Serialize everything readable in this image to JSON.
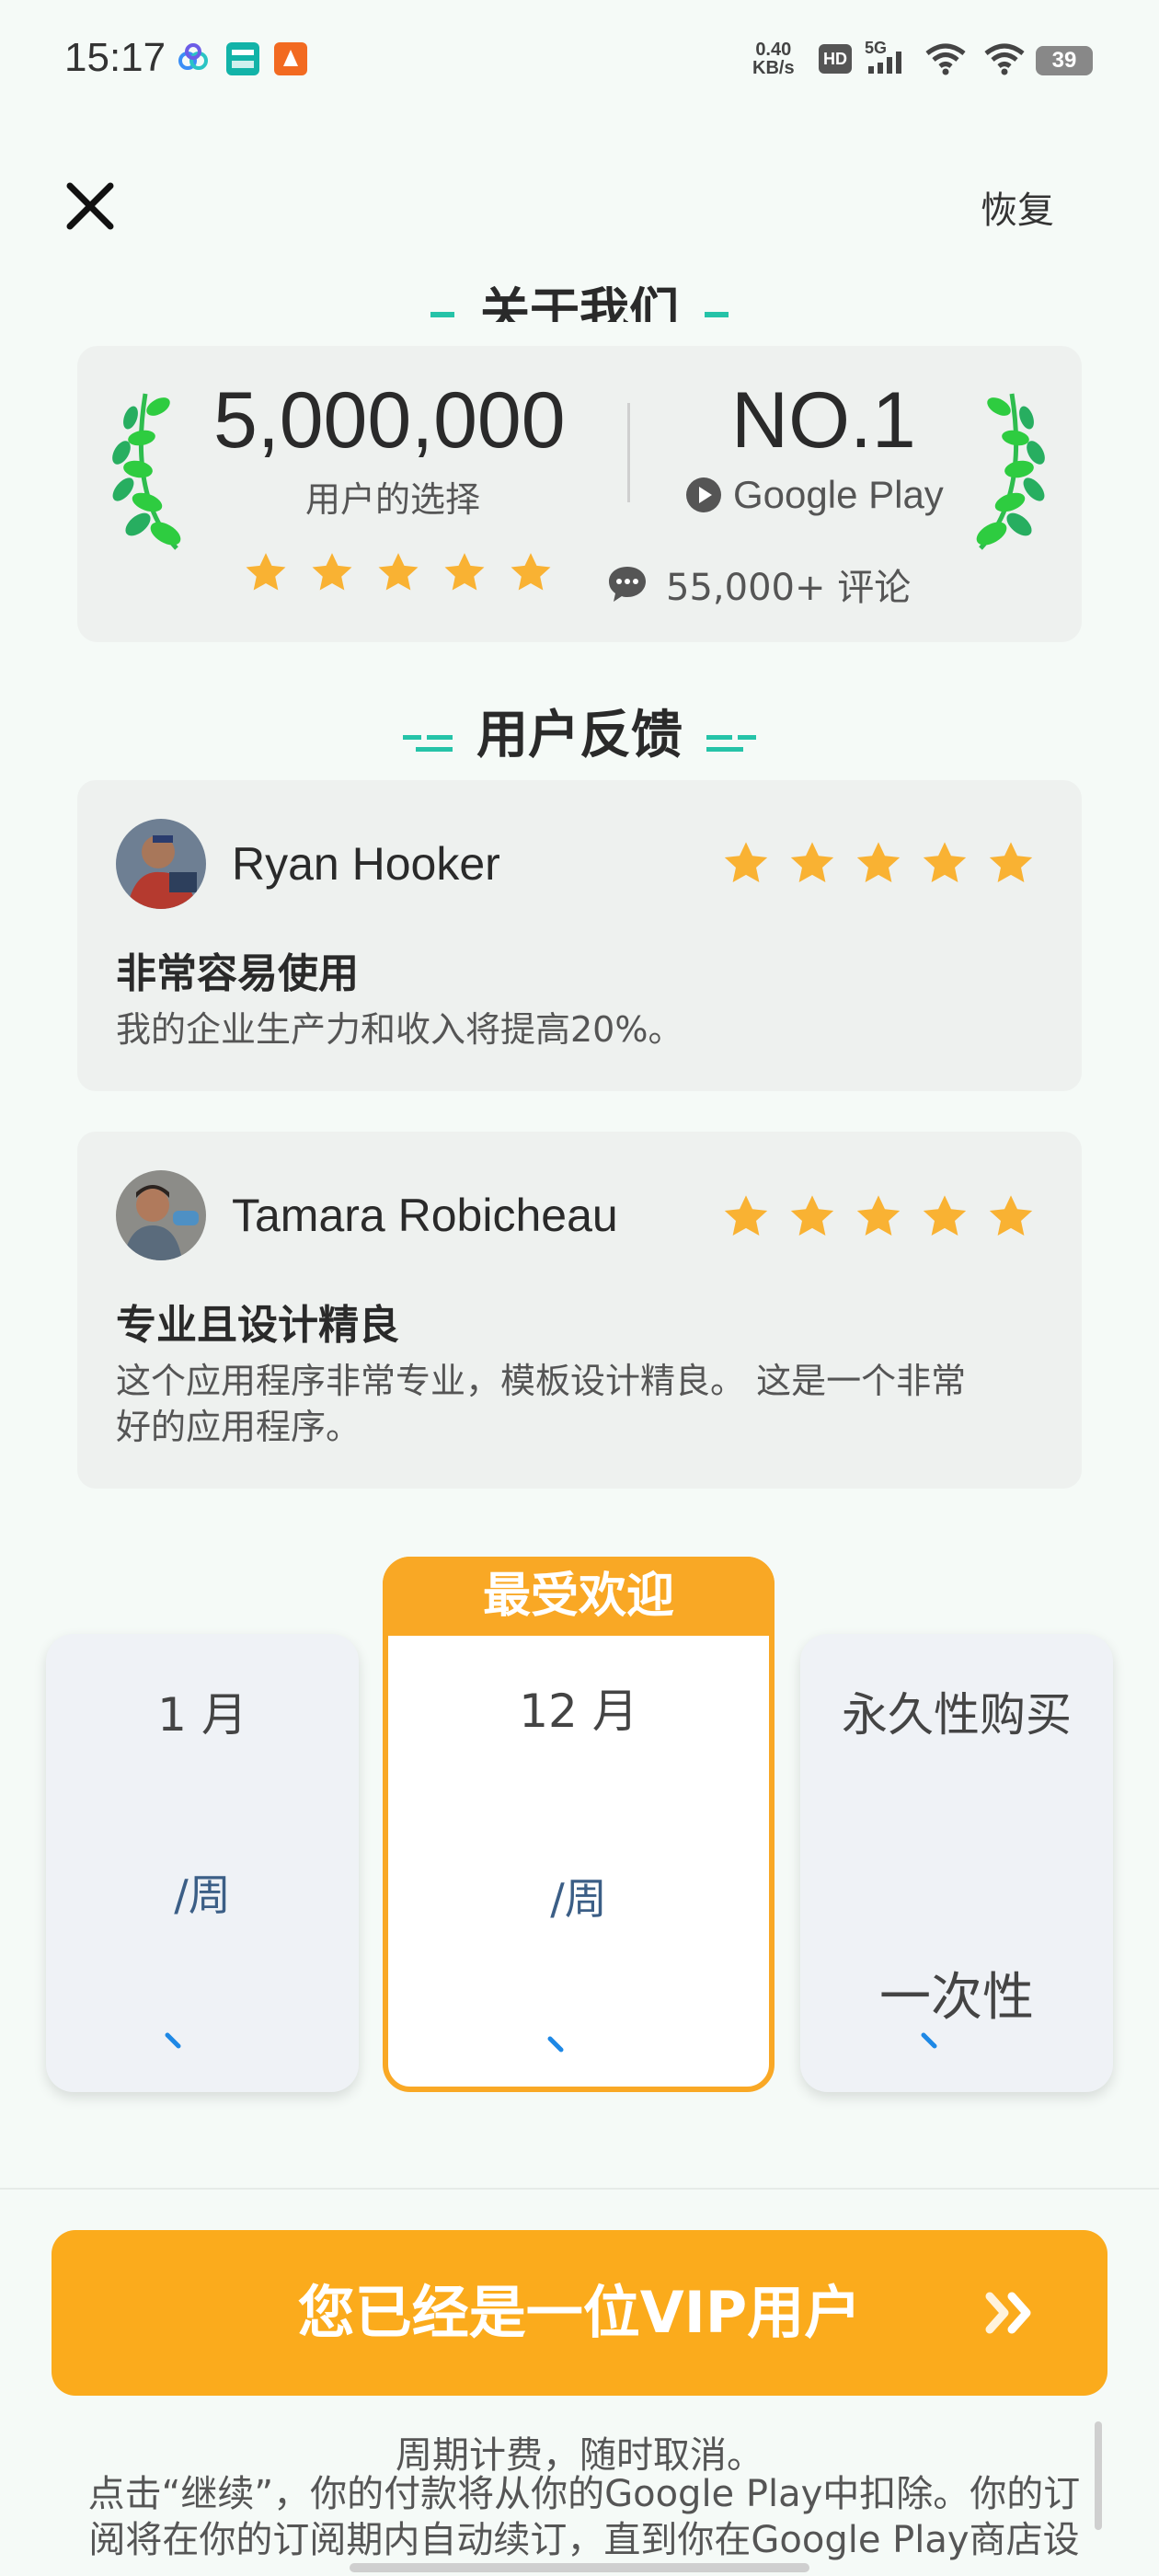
{
  "status_bar": {
    "time": "15:17",
    "net_speed_value": "0.40",
    "net_speed_unit": "KB/s",
    "hd": "HD",
    "signal": "5G",
    "battery": "39",
    "app_icons": [
      "baidu-netdisk-icon",
      "boss-zhipin-icon",
      "app-icon"
    ]
  },
  "header": {
    "close_icon": "close-icon",
    "restore_label": "恢复"
  },
  "about": {
    "title": "关于我们",
    "users_value": "5,000,000",
    "users_label": "用户的选择",
    "rank_value": "NO.1",
    "rank_label": "Google Play",
    "reviews_label": "55,000+ 评论",
    "stars": 5
  },
  "feedback": {
    "title": "用户反馈",
    "reviews": [
      {
        "name": "Ryan Hooker",
        "rating": 5,
        "title": "非常容易使用",
        "body": "我的企业生产力和收入将提高20%。"
      },
      {
        "name": "Tamara Robicheau",
        "rating": 5,
        "title": "专业且设计精良",
        "body_line1": "这个应用程序非常专业，模板设计精良。 这是一个非常",
        "body_line2": "好的应用程序。"
      }
    ]
  },
  "plans": {
    "popular_badge": "最受欢迎",
    "items": [
      {
        "name": "1 月",
        "per": "/周"
      },
      {
        "name": "12 月",
        "per": "/周"
      },
      {
        "name": "永久性购买",
        "per": "一次性"
      }
    ]
  },
  "cta": {
    "label": "您已经是一位VIP用户"
  },
  "footer": {
    "billing_note": "周期计费，随时取消。",
    "terms_line1": "点击“继续”，你的付款将从你的Google Play中扣除。你的订",
    "terms_line2": "阅将在你的订阅期内自动续订，直到你在Google Play商店设"
  },
  "colors": {
    "accent": "#f9a825",
    "star": "#f9b233",
    "laurel": "#2ecc40",
    "plan_text": "#3b5e86"
  }
}
